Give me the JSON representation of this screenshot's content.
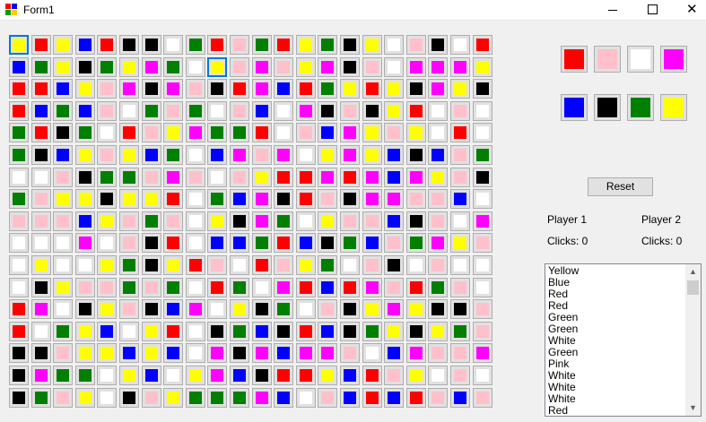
{
  "window": {
    "title": "Form1"
  },
  "colors": {
    "R": "#ff0000",
    "Y": "#ffff00",
    "B": "#0000ff",
    "K": "#000000",
    "G": "#007f00",
    "P": "#ffc0cb",
    "W": "#ffffff",
    "M": "#ff00ff"
  },
  "grid": {
    "rows": [
      "YRYBRKKWGRPGRYGKYWPKWR",
      "BGYKGYMGWYPMPYMKPWMMMY",
      "RRBYPMKMPKRMBRGYRYKMYK",
      "RBGBPWGPGWPBWMKPKYRWPW",
      "GRKGWRPYMGGRWPBMYPYWRW",
      "GKBYPYBGWBMPMWYMYBKBPG",
      "WWPKGGPMPWPYRRMRMBMYPK",
      "GPYYKYYRWGBMKRPKMMPPBW",
      "PPPBYPGPWYKMGWYPPBKPWM",
      "WWWMWPKRWBBGRBKGBPGMYP",
      "WYWWYGKYRPWRPYGWPKWPWW",
      "WKYPPGPGWRGWMRBRMPRGPW",
      "RMWKYPKBMWYKGWPKYMYKKP",
      "RWGYBWYRWKGBKRBKGYKYGP",
      "KKPYYBYBWMKMBMMPWBMPPM",
      "KMGGWYBWYMBKRRYBRPYWPW",
      "KGPYWKPYGGGMBWPBRBRPBP"
    ],
    "selected": {
      "row": 0,
      "col": 0
    },
    "focus_ring": {
      "row": 1,
      "col": 9
    }
  },
  "palette": {
    "top": [
      "R",
      "P",
      "W",
      "M"
    ],
    "bottom": [
      "B",
      "K",
      "G",
      "Y"
    ]
  },
  "reset_label": "Reset",
  "players": [
    {
      "name": "Player 1",
      "clicks": "Clicks: 0"
    },
    {
      "name": "Player 2",
      "clicks": "Clicks: 0"
    }
  ],
  "log": [
    "Yellow",
    "Blue",
    "Red",
    "Red",
    "Green",
    "Green",
    "White",
    "Green",
    "Pink",
    "White",
    "White",
    "White",
    "Red"
  ]
}
